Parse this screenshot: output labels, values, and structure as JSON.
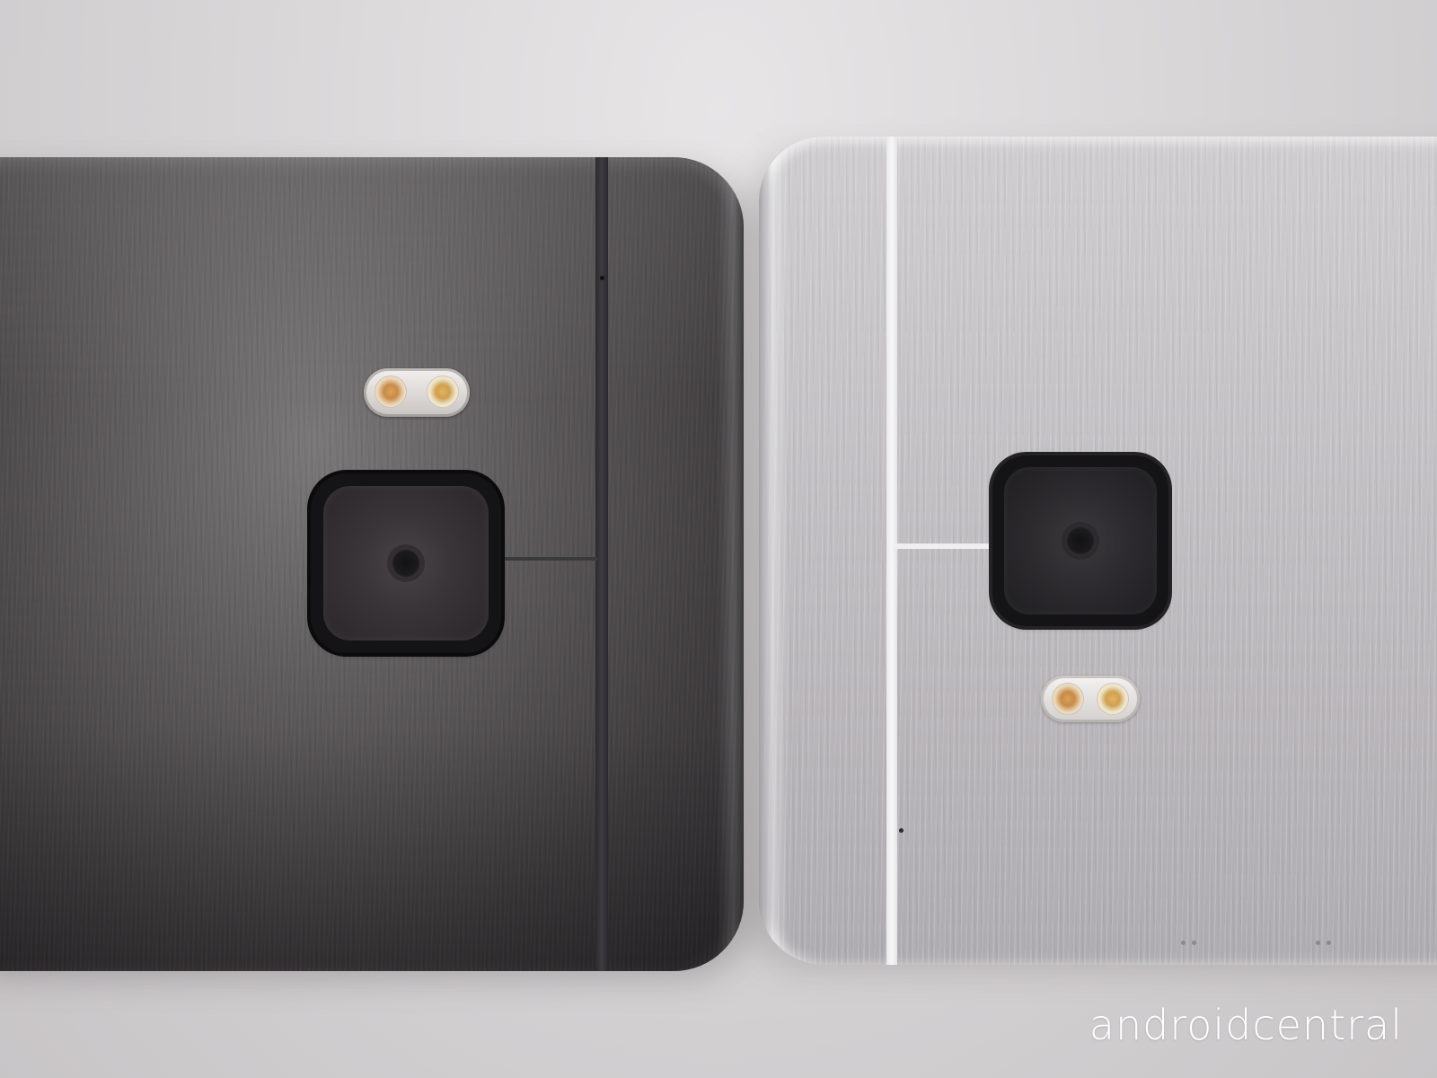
{
  "photo": {
    "description_colors": {
      "background": "#d7d5d6",
      "left_phone_body": "#5d5a5b",
      "right_phone_body": "#c4c2c5",
      "camera_ring": "#141315",
      "flash_led": "#d9a25a"
    }
  },
  "watermark": {
    "text": "androidcentral",
    "color": "#ffffff"
  }
}
